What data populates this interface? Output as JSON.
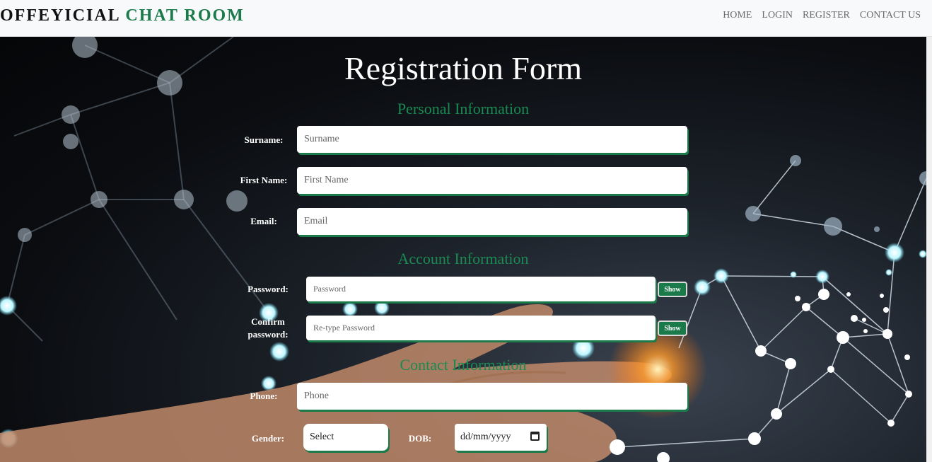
{
  "navbar": {
    "brand_primary": "OFFEYICIAL",
    "brand_accent": "CHAT ROOM",
    "links": [
      "HOME",
      "LOGIN",
      "REGISTER",
      "CONTACT US"
    ]
  },
  "form": {
    "title": "Registration Form",
    "sections": {
      "personal": "Personal Information",
      "account": "Account Information",
      "contact": "Contact Information"
    },
    "fields": {
      "surname": {
        "label": "Surname:",
        "placeholder": "Surname"
      },
      "first_name": {
        "label": "First Name:",
        "placeholder": "First Name"
      },
      "email": {
        "label": "Email:",
        "placeholder": "Email"
      },
      "password": {
        "label": "Password:",
        "placeholder": "Password",
        "toggle": "Show"
      },
      "confirm_password": {
        "label_line1": "Confirm",
        "label_line2": "password:",
        "placeholder": "Re-type Password",
        "toggle": "Show"
      },
      "phone": {
        "label": "Phone:",
        "placeholder": "Phone"
      },
      "gender": {
        "label": "Gender:",
        "value": "Select"
      },
      "dob": {
        "label": "DOB:",
        "value": "dd/mm/yyyy"
      }
    }
  },
  "colors": {
    "accent": "#1a7a4a",
    "section_heading": "#1a8a52"
  },
  "icons": {
    "dob_picker": "calendar-icon"
  }
}
